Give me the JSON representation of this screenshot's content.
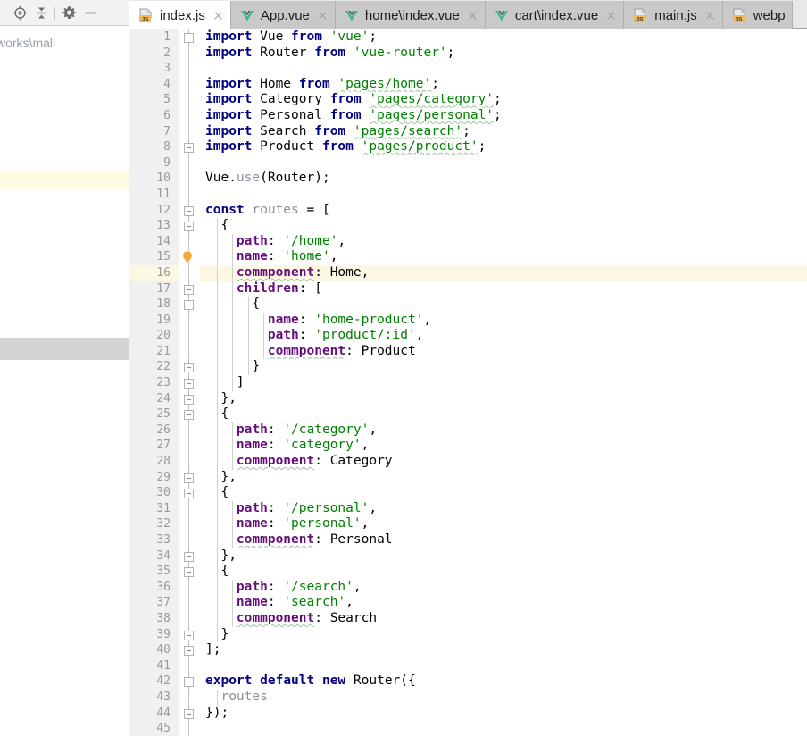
{
  "left_panel": {
    "toolbar": [
      {
        "name": "locate-icon",
        "label": "Select Opened File"
      },
      {
        "name": "collapse-all-icon",
        "label": "Collapse All"
      },
      {
        "name": "gear-icon",
        "label": "Settings"
      },
      {
        "name": "minimize-icon",
        "label": "Hide"
      }
    ],
    "breadcrumb": "works\\mall"
  },
  "tabs": [
    {
      "label": "index.js",
      "icon": "js-file-icon",
      "active": true,
      "closable": true
    },
    {
      "label": "App.vue",
      "icon": "vue-file-icon",
      "active": false,
      "closable": true
    },
    {
      "label": "home\\index.vue",
      "icon": "vue-file-icon",
      "active": false,
      "closable": true
    },
    {
      "label": "cart\\index.vue",
      "icon": "vue-file-icon",
      "active": false,
      "closable": true
    },
    {
      "label": "main.js",
      "icon": "js-file-icon",
      "active": false,
      "closable": true
    },
    {
      "label": "webp",
      "icon": "js-file-icon",
      "active": false,
      "closable": false
    }
  ],
  "editor": {
    "current_line": 16,
    "bulb_line": 15,
    "first_line": 1,
    "last_line": 45,
    "lines": [
      {
        "n": 1,
        "fold": "top",
        "indent": 0,
        "html": "<span class=\"kw\">import</span> Vue <span class=\"kw\">from</span> <span class=\"str\">'vue'</span>;"
      },
      {
        "n": 2,
        "fold": "",
        "indent": 0,
        "html": "<span class=\"kw\">import</span> Router <span class=\"kw\">from</span> <span class=\"str\">'vue-router'</span>;"
      },
      {
        "n": 3,
        "fold": "",
        "indent": 0,
        "html": ""
      },
      {
        "n": 4,
        "fold": "",
        "indent": 0,
        "html": "<span class=\"kw\">import</span> Home <span class=\"kw\">from</span> <span class=\"str sq\">'pages/home'</span>;"
      },
      {
        "n": 5,
        "fold": "",
        "indent": 0,
        "html": "<span class=\"kw\">import</span> Category <span class=\"kw\">from</span> <span class=\"str sq\">'pages/category'</span>;"
      },
      {
        "n": 6,
        "fold": "",
        "indent": 0,
        "html": "<span class=\"kw\">import</span> Personal <span class=\"kw\">from</span> <span class=\"str sq\">'pages/personal'</span>;"
      },
      {
        "n": 7,
        "fold": "",
        "indent": 0,
        "html": "<span class=\"kw\">import</span> Search <span class=\"kw\">from</span> <span class=\"str sq\">'pages/search'</span>;"
      },
      {
        "n": 8,
        "fold": "bot",
        "indent": 0,
        "html": "<span class=\"kw\">import</span> Product <span class=\"kw\">from</span> <span class=\"str sq\">'pages/product'</span>;"
      },
      {
        "n": 9,
        "fold": "",
        "indent": 0,
        "html": ""
      },
      {
        "n": 10,
        "fold": "",
        "indent": 0,
        "html": "Vue.<span class=\"dim\">use</span>(Router);"
      },
      {
        "n": 11,
        "fold": "",
        "indent": 0,
        "html": ""
      },
      {
        "n": 12,
        "fold": "top",
        "indent": 0,
        "html": "<span class=\"kw\">const</span> <span class=\"dim\">routes</span> = ["
      },
      {
        "n": 13,
        "fold": "top",
        "indent": 1,
        "html": "  {"
      },
      {
        "n": 14,
        "fold": "",
        "indent": 2,
        "html": "    <span class=\"prop\">path</span>: <span class=\"str\">'/home'</span>,"
      },
      {
        "n": 15,
        "fold": "",
        "indent": 2,
        "html": "    <span class=\"prop\">name</span>: <span class=\"str\">'home'</span>,"
      },
      {
        "n": 16,
        "fold": "",
        "indent": 2,
        "html": "    <span class=\"prop sq\">commponent</span>: Home,"
      },
      {
        "n": 17,
        "fold": "top",
        "indent": 2,
        "html": "    <span class=\"prop\">children</span>: ["
      },
      {
        "n": 18,
        "fold": "top",
        "indent": 3,
        "html": "      {"
      },
      {
        "n": 19,
        "fold": "",
        "indent": 4,
        "html": "        <span class=\"prop\">name</span>: <span class=\"str\">'home-product'</span>,"
      },
      {
        "n": 20,
        "fold": "",
        "indent": 4,
        "html": "        <span class=\"prop\">path</span>: <span class=\"str\">'product/:id'</span>,"
      },
      {
        "n": 21,
        "fold": "",
        "indent": 4,
        "html": "        <span class=\"prop sq\">commponent</span>: Product"
      },
      {
        "n": 22,
        "fold": "bot",
        "indent": 3,
        "html": "      }"
      },
      {
        "n": 23,
        "fold": "bot",
        "indent": 2,
        "html": "    ]"
      },
      {
        "n": 24,
        "fold": "bot",
        "indent": 1,
        "html": "  },"
      },
      {
        "n": 25,
        "fold": "top",
        "indent": 1,
        "html": "  {"
      },
      {
        "n": 26,
        "fold": "",
        "indent": 2,
        "html": "    <span class=\"prop\">path</span>: <span class=\"str\">'/category'</span>,"
      },
      {
        "n": 27,
        "fold": "",
        "indent": 2,
        "html": "    <span class=\"prop\">name</span>: <span class=\"str\">'category'</span>,"
      },
      {
        "n": 28,
        "fold": "",
        "indent": 2,
        "html": "    <span class=\"prop sq\">commponent</span>: Category"
      },
      {
        "n": 29,
        "fold": "bot",
        "indent": 1,
        "html": "  },"
      },
      {
        "n": 30,
        "fold": "top",
        "indent": 1,
        "html": "  {"
      },
      {
        "n": 31,
        "fold": "",
        "indent": 2,
        "html": "    <span class=\"prop\">path</span>: <span class=\"str\">'/personal'</span>,"
      },
      {
        "n": 32,
        "fold": "",
        "indent": 2,
        "html": "    <span class=\"prop\">name</span>: <span class=\"str\">'personal'</span>,"
      },
      {
        "n": 33,
        "fold": "",
        "indent": 2,
        "html": "    <span class=\"prop sq\">commponent</span>: Personal"
      },
      {
        "n": 34,
        "fold": "bot",
        "indent": 1,
        "html": "  },"
      },
      {
        "n": 35,
        "fold": "top",
        "indent": 1,
        "html": "  {"
      },
      {
        "n": 36,
        "fold": "",
        "indent": 2,
        "html": "    <span class=\"prop\">path</span>: <span class=\"str\">'/search'</span>,"
      },
      {
        "n": 37,
        "fold": "",
        "indent": 2,
        "html": "    <span class=\"prop\">name</span>: <span class=\"str\">'search'</span>,"
      },
      {
        "n": 38,
        "fold": "",
        "indent": 2,
        "html": "    <span class=\"prop sq\">commponent</span>: Search"
      },
      {
        "n": 39,
        "fold": "bot",
        "indent": 1,
        "html": "  }"
      },
      {
        "n": 40,
        "fold": "bot",
        "indent": 0,
        "html": "];"
      },
      {
        "n": 41,
        "fold": "",
        "indent": 0,
        "html": ""
      },
      {
        "n": 42,
        "fold": "top",
        "indent": 0,
        "html": "<span class=\"kw\">export</span> <span class=\"kw\">default</span> <span class=\"kw\">new</span> Router({"
      },
      {
        "n": 43,
        "fold": "",
        "indent": 1,
        "html": "  <span class=\"dim\">routes</span>"
      },
      {
        "n": 44,
        "fold": "bot",
        "indent": 0,
        "html": "});"
      },
      {
        "n": 45,
        "fold": "",
        "indent": 0,
        "html": ""
      }
    ]
  },
  "colors": {
    "keyword": "#000080",
    "string": "#008000",
    "property": "#660e7a",
    "dim_identifier": "#8a9099",
    "current_line_bg": "#fdf8e3",
    "gutter_bg": "#f0f0f0",
    "tab_inactive_bg": "#c9c9c9",
    "tab_active_bg": "#ffffff",
    "bulb": "#f2a93b",
    "tree_selection_bg": "#d4d4d4",
    "tree_highlight_bg": "#fdfde4"
  }
}
